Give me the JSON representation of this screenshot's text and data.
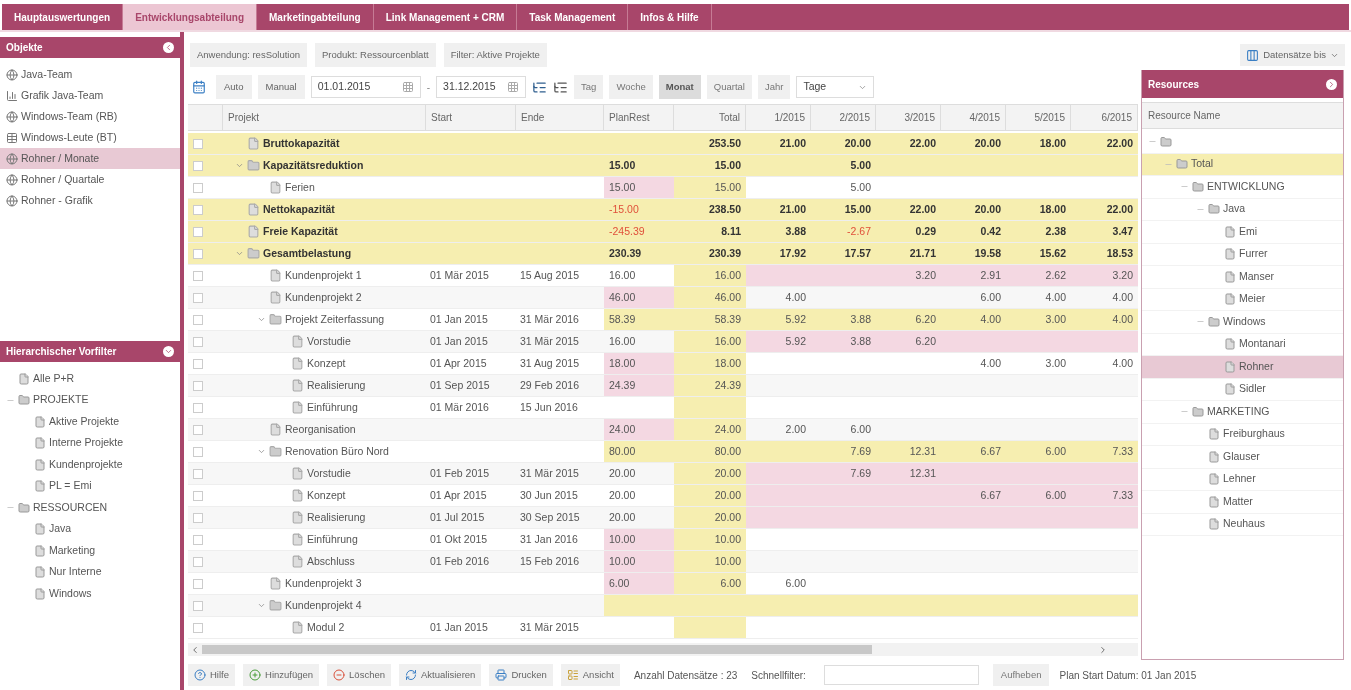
{
  "nav_tabs": [
    {
      "label": "Hauptauswertungen",
      "selected": false
    },
    {
      "label": "Entwicklungsabteilung",
      "selected": true
    },
    {
      "label": "Marketingabteilung",
      "selected": false
    },
    {
      "label": "Link Management + CRM",
      "selected": false
    },
    {
      "label": "Task Management",
      "selected": false
    },
    {
      "label": "Infos & Hilfe",
      "selected": false
    }
  ],
  "objects_panel": {
    "title": "Objekte",
    "items": [
      {
        "label": "Java-Team",
        "kind": "view",
        "selected": false
      },
      {
        "label": "Grafik Java-Team",
        "kind": "chart",
        "selected": false
      },
      {
        "label": "Windows-Team (RB)",
        "kind": "view",
        "selected": false
      },
      {
        "label": "Windows-Leute (BT)",
        "kind": "table",
        "selected": false
      },
      {
        "label": "Rohner / Monate",
        "kind": "view",
        "selected": true
      },
      {
        "label": "Rohner / Quartale",
        "kind": "view",
        "selected": false
      },
      {
        "label": "Rohner - Grafik",
        "kind": "view",
        "selected": false
      }
    ]
  },
  "prefilter_panel": {
    "title": "Hierarchischer Vorfilter",
    "items": [
      {
        "label": "Alle P+R"
      },
      {
        "label": "PROJEKTE",
        "children": [
          {
            "label": "Aktive Projekte"
          },
          {
            "label": "Interne Projekte"
          },
          {
            "label": "Kundenprojekte"
          },
          {
            "label": "PL = Emi"
          }
        ]
      },
      {
        "label": "RESSOURCEN",
        "children": [
          {
            "label": "Java"
          },
          {
            "label": "Marketing"
          },
          {
            "label": "Nur Interne"
          },
          {
            "label": "Windows"
          }
        ]
      }
    ]
  },
  "context_chips": [
    "Anwendung: resSolution",
    "Produkt: Ressourcenblatt",
    "Filter: Aktive Projekte"
  ],
  "records_menu": {
    "label": "Datensätze bis"
  },
  "toolbar": {
    "modes": [
      "Auto",
      "Manual"
    ],
    "date_from": "01.01.2015",
    "separator": "-",
    "date_to": "31.12.2015",
    "periods": [
      {
        "label": "Tag",
        "selected": false
      },
      {
        "label": "Woche",
        "selected": false
      },
      {
        "label": "Monat",
        "selected": true
      },
      {
        "label": "Quartal",
        "selected": false
      },
      {
        "label": "Jahr",
        "selected": false
      }
    ],
    "unit_select": {
      "value": "Tage"
    }
  },
  "table": {
    "columns": [
      "Projekt",
      "Start",
      "Ende",
      "PlanRest",
      "Total",
      "1/2015",
      "2/2015",
      "3/2015",
      "4/2015",
      "5/2015",
      "6/2015"
    ],
    "rows": [
      {
        "name": "Bruttokapazität",
        "kind": "summary",
        "checked": false,
        "values": [
          {
            "flagged": false
          },
          {
            "text": "253.50",
            "flagged": false,
            "negative": false
          },
          {
            "text": "21.00",
            "flagged": false,
            "negative": false
          },
          {
            "text": "20.00",
            "flagged": false,
            "negative": false
          },
          {
            "text": "22.00",
            "flagged": false,
            "negative": false
          },
          {
            "text": "20.00",
            "flagged": false,
            "negative": false
          },
          {
            "text": "18.00",
            "flagged": false,
            "negative": false
          },
          {
            "text": "22.00",
            "flagged": false,
            "negative": false
          }
        ]
      },
      {
        "name": "Kapazitätsreduktion",
        "kind": "summary",
        "checked": false,
        "expanded": true,
        "values": [
          {
            "text": "15.00",
            "flagged": false,
            "negative": false
          },
          {
            "text": "15.00",
            "flagged": false,
            "negative": false
          },
          {
            "flagged": false
          },
          {
            "text": "5.00",
            "flagged": false,
            "negative": false
          },
          {
            "flagged": false
          },
          {
            "flagged": false
          },
          {
            "flagged": false
          },
          {
            "flagged": false
          }
        ],
        "children": [
          {
            "name": "Ferien",
            "kind": "task",
            "checked": false,
            "values": [
              {
                "text": "15.00",
                "flagged": true,
                "negative": false
              },
              {
                "text": "15.00",
                "flagged": false,
                "negative": false
              },
              {
                "flagged": false
              },
              {
                "text": "5.00",
                "flagged": false,
                "negative": false
              },
              {
                "flagged": false
              },
              {
                "flagged": false
              },
              {
                "flagged": false
              },
              {
                "flagged": false
              }
            ]
          }
        ]
      },
      {
        "name": "Nettokapazität",
        "kind": "summary",
        "checked": false,
        "values": [
          {
            "text": "-15.00",
            "flagged": false,
            "negative": true
          },
          {
            "text": "238.50",
            "flagged": false,
            "negative": false
          },
          {
            "text": "21.00",
            "flagged": false,
            "negative": false
          },
          {
            "text": "15.00",
            "flagged": false,
            "negative": false
          },
          {
            "text": "22.00",
            "flagged": false,
            "negative": false
          },
          {
            "text": "20.00",
            "flagged": false,
            "negative": false
          },
          {
            "text": "18.00",
            "flagged": false,
            "negative": false
          },
          {
            "text": "22.00",
            "flagged": false,
            "negative": false
          }
        ]
      },
      {
        "name": "Freie Kapazität",
        "kind": "summary",
        "checked": false,
        "values": [
          {
            "text": "-245.39",
            "flagged": false,
            "negative": true
          },
          {
            "text": "8.11",
            "flagged": false,
            "negative": false
          },
          {
            "text": "3.88",
            "flagged": false,
            "negative": false
          },
          {
            "text": "-2.67",
            "flagged": false,
            "negative": true
          },
          {
            "text": "0.29",
            "flagged": false,
            "negative": false
          },
          {
            "text": "0.42",
            "flagged": false,
            "negative": false
          },
          {
            "text": "2.38",
            "flagged": false,
            "negative": false
          },
          {
            "text": "3.47",
            "flagged": false,
            "negative": false
          }
        ]
      },
      {
        "name": "Gesamtbelastung",
        "kind": "summary",
        "checked": false,
        "expanded": true,
        "values": [
          {
            "text": "230.39",
            "flagged": false,
            "negative": false
          },
          {
            "text": "230.39",
            "flagged": false,
            "negative": false
          },
          {
            "text": "17.92",
            "flagged": false,
            "negative": false
          },
          {
            "text": "17.57",
            "flagged": false,
            "negative": false
          },
          {
            "text": "21.71",
            "flagged": false,
            "negative": false
          },
          {
            "text": "19.58",
            "flagged": false,
            "negative": false
          },
          {
            "text": "15.62",
            "flagged": false,
            "negative": false
          },
          {
            "text": "18.53",
            "flagged": false,
            "negative": false
          }
        ],
        "children": [
          {
            "name": "Kundenprojekt 1",
            "kind": "task",
            "checked": false,
            "start": "01 Mär 2015",
            "end": "15 Aug 2015",
            "values": [
              {
                "text": "16.00",
                "flagged": false,
                "negative": false
              },
              {
                "text": "16.00",
                "flagged": false,
                "negative": false
              },
              {
                "flagged": true
              },
              {
                "flagged": true
              },
              {
                "text": "3.20",
                "flagged": true,
                "negative": false
              },
              {
                "text": "2.91",
                "flagged": true,
                "negative": false
              },
              {
                "text": "2.62",
                "flagged": true,
                "negative": false
              },
              {
                "text": "3.20",
                "flagged": true,
                "negative": false
              }
            ]
          },
          {
            "name": "Kundenprojekt 2",
            "kind": "task",
            "checked": false,
            "values": [
              {
                "text": "46.00",
                "flagged": true,
                "negative": false
              },
              {
                "text": "46.00",
                "flagged": false,
                "negative": false
              },
              {
                "text": "4.00",
                "flagged": false,
                "negative": false
              },
              {
                "flagged": false
              },
              {
                "flagged": false
              },
              {
                "text": "6.00",
                "flagged": false,
                "negative": false
              },
              {
                "text": "4.00",
                "flagged": false,
                "negative": false
              },
              {
                "text": "4.00",
                "flagged": false,
                "negative": false
              }
            ]
          },
          {
            "name": "Projekt Zeiterfassung",
            "kind": "group",
            "checked": false,
            "expanded": true,
            "start": "01 Jan 2015",
            "end": "31 Mär 2016",
            "values": [
              {
                "text": "58.39",
                "flagged": false,
                "negative": false
              },
              {
                "text": "58.39",
                "flagged": false,
                "negative": false
              },
              {
                "text": "5.92",
                "flagged": false,
                "negative": false
              },
              {
                "text": "3.88",
                "flagged": false,
                "negative": false
              },
              {
                "text": "6.20",
                "flagged": false,
                "negative": false
              },
              {
                "text": "4.00",
                "flagged": false,
                "negative": false
              },
              {
                "text": "3.00",
                "flagged": false,
                "negative": false
              },
              {
                "text": "4.00",
                "flagged": false,
                "negative": false
              }
            ],
            "children": [
              {
                "name": "Vorstudie",
                "kind": "task",
                "checked": false,
                "start": "01 Jan 2015",
                "end": "31 Mär 2015",
                "values": [
                  {
                    "text": "16.00",
                    "flagged": false,
                    "negative": false
                  },
                  {
                    "text": "16.00",
                    "flagged": false,
                    "negative": false
                  },
                  {
                    "text": "5.92",
                    "flagged": true,
                    "negative": false
                  },
                  {
                    "text": "3.88",
                    "flagged": true,
                    "negative": false
                  },
                  {
                    "text": "6.20",
                    "flagged": true,
                    "negative": false
                  },
                  {
                    "flagged": true
                  },
                  {
                    "flagged": true
                  },
                  {
                    "flagged": true
                  }
                ]
              },
              {
                "name": "Konzept",
                "kind": "task",
                "checked": false,
                "start": "01 Apr 2015",
                "end": "31 Aug 2015",
                "values": [
                  {
                    "text": "18.00",
                    "flagged": true,
                    "negative": false
                  },
                  {
                    "text": "18.00",
                    "flagged": false,
                    "negative": false
                  },
                  {
                    "flagged": false
                  },
                  {
                    "flagged": false
                  },
                  {
                    "flagged": false
                  },
                  {
                    "text": "4.00",
                    "flagged": false,
                    "negative": false
                  },
                  {
                    "text": "3.00",
                    "flagged": false,
                    "negative": false
                  },
                  {
                    "text": "4.00",
                    "flagged": false,
                    "negative": false
                  }
                ]
              },
              {
                "name": "Realisierung",
                "kind": "task",
                "checked": false,
                "start": "01 Sep 2015",
                "end": "29 Feb 2016",
                "values": [
                  {
                    "text": "24.39",
                    "flagged": true,
                    "negative": false
                  },
                  {
                    "text": "24.39",
                    "flagged": false,
                    "negative": false
                  },
                  {
                    "flagged": false
                  },
                  {
                    "flagged": false
                  },
                  {
                    "flagged": false
                  },
                  {
                    "flagged": false
                  },
                  {
                    "flagged": false
                  },
                  {
                    "flagged": false
                  }
                ]
              },
              {
                "name": "Einführung",
                "kind": "task",
                "checked": false,
                "start": "01 Mär 2016",
                "end": "15 Jun 2016",
                "values": [
                  {
                    "flagged": false
                  },
                  {
                    "flagged": false
                  },
                  {
                    "flagged": false
                  },
                  {
                    "flagged": false
                  },
                  {
                    "flagged": false
                  },
                  {
                    "flagged": false
                  },
                  {
                    "flagged": false
                  },
                  {
                    "flagged": false
                  }
                ]
              }
            ]
          },
          {
            "name": "Reorganisation",
            "kind": "task",
            "checked": false,
            "values": [
              {
                "text": "24.00",
                "flagged": true,
                "negative": false
              },
              {
                "text": "24.00",
                "flagged": false,
                "negative": false
              },
              {
                "text": "2.00",
                "flagged": false,
                "negative": false
              },
              {
                "text": "6.00",
                "flagged": false,
                "negative": false
              },
              {
                "flagged": false
              },
              {
                "flagged": false
              },
              {
                "flagged": false
              },
              {
                "flagged": false
              }
            ]
          },
          {
            "name": "Renovation Büro Nord",
            "kind": "group",
            "checked": false,
            "expanded": true,
            "values": [
              {
                "text": "80.00",
                "flagged": false,
                "negative": false
              },
              {
                "text": "80.00",
                "flagged": false,
                "negative": false
              },
              {
                "flagged": false
              },
              {
                "text": "7.69",
                "flagged": false,
                "negative": false
              },
              {
                "text": "12.31",
                "flagged": false,
                "negative": false
              },
              {
                "text": "6.67",
                "flagged": false,
                "negative": false
              },
              {
                "text": "6.00",
                "flagged": false,
                "negative": false
              },
              {
                "text": "7.33",
                "flagged": false,
                "negative": false
              }
            ],
            "children": [
              {
                "name": "Vorstudie",
                "kind": "task",
                "checked": false,
                "start": "01 Feb 2015",
                "end": "31 Mär 2015",
                "values": [
                  {
                    "text": "20.00",
                    "flagged": false,
                    "negative": false
                  },
                  {
                    "text": "20.00",
                    "flagged": false,
                    "negative": false
                  },
                  {
                    "flagged": true
                  },
                  {
                    "text": "7.69",
                    "flagged": true,
                    "negative": false
                  },
                  {
                    "text": "12.31",
                    "flagged": true,
                    "negative": false
                  },
                  {
                    "flagged": true
                  },
                  {
                    "flagged": true
                  },
                  {
                    "flagged": true
                  }
                ]
              },
              {
                "name": "Konzept",
                "kind": "task",
                "checked": false,
                "start": "01 Apr 2015",
                "end": "30 Jun 2015",
                "values": [
                  {
                    "text": "20.00",
                    "flagged": false,
                    "negative": false
                  },
                  {
                    "text": "20.00",
                    "flagged": false,
                    "negative": false
                  },
                  {
                    "flagged": true
                  },
                  {
                    "flagged": true
                  },
                  {
                    "flagged": true
                  },
                  {
                    "text": "6.67",
                    "flagged": true,
                    "negative": false
                  },
                  {
                    "text": "6.00",
                    "flagged": true,
                    "negative": false
                  },
                  {
                    "text": "7.33",
                    "flagged": true,
                    "negative": false
                  }
                ]
              },
              {
                "name": "Realisierung",
                "kind": "task",
                "checked": false,
                "start": "01 Jul 2015",
                "end": "30 Sep 2015",
                "values": [
                  {
                    "text": "20.00",
                    "flagged": false,
                    "negative": false
                  },
                  {
                    "text": "20.00",
                    "flagged": false,
                    "negative": false
                  },
                  {
                    "flagged": true
                  },
                  {
                    "flagged": true
                  },
                  {
                    "flagged": true
                  },
                  {
                    "flagged": true
                  },
                  {
                    "flagged": true
                  },
                  {
                    "flagged": true
                  }
                ]
              },
              {
                "name": "Einführung",
                "kind": "task",
                "checked": false,
                "start": "01 Okt 2015",
                "end": "31 Jan 2016",
                "values": [
                  {
                    "text": "10.00",
                    "flagged": true,
                    "negative": false
                  },
                  {
                    "text": "10.00",
                    "flagged": false,
                    "negative": false
                  },
                  {
                    "flagged": false
                  },
                  {
                    "flagged": false
                  },
                  {
                    "flagged": false
                  },
                  {
                    "flagged": false
                  },
                  {
                    "flagged": false
                  },
                  {
                    "flagged": false
                  }
                ]
              },
              {
                "name": "Abschluss",
                "kind": "task",
                "checked": false,
                "start": "01 Feb 2016",
                "end": "15 Feb 2016",
                "values": [
                  {
                    "text": "10.00",
                    "flagged": true,
                    "negative": false
                  },
                  {
                    "text": "10.00",
                    "flagged": false,
                    "negative": false
                  },
                  {
                    "flagged": false
                  },
                  {
                    "flagged": false
                  },
                  {
                    "flagged": false
                  },
                  {
                    "flagged": false
                  },
                  {
                    "flagged": false
                  },
                  {
                    "flagged": false
                  }
                ]
              }
            ]
          },
          {
            "name": "Kundenprojekt 3",
            "kind": "task",
            "checked": false,
            "values": [
              {
                "text": "6.00",
                "flagged": true,
                "negative": false
              },
              {
                "text": "6.00",
                "flagged": false,
                "negative": false
              },
              {
                "text": "6.00",
                "flagged": false,
                "negative": false
              },
              {
                "flagged": false
              },
              {
                "flagged": false
              },
              {
                "flagged": false
              },
              {
                "flagged": false
              },
              {
                "flagged": false
              }
            ]
          },
          {
            "name": "Kundenprojekt 4",
            "kind": "group",
            "checked": false,
            "expanded": true,
            "values": [
              {
                "flagged": false
              },
              {
                "flagged": false
              },
              {
                "flagged": false
              },
              {
                "flagged": false
              },
              {
                "flagged": false
              },
              {
                "flagged": false
              },
              {
                "flagged": false
              },
              {
                "flagged": false
              }
            ],
            "children": [
              {
                "name": "Modul 2",
                "kind": "task",
                "checked": false,
                "start": "01 Jan 2015",
                "end": "31 Mär 2015",
                "values": [
                  {
                    "flagged": false
                  },
                  {
                    "flagged": false
                  },
                  {
                    "flagged": false
                  },
                  {
                    "flagged": false
                  },
                  {
                    "flagged": false
                  },
                  {
                    "flagged": false
                  },
                  {
                    "flagged": false
                  },
                  {
                    "flagged": false
                  }
                ]
              }
            ]
          }
        ]
      }
    ]
  },
  "resources_panel": {
    "title": "Resources",
    "column": "Resource Name",
    "items": [
      {
        "kind": "folder",
        "selected": false,
        "children": [
          {
            "label": "Total",
            "kind": "total",
            "selected": false,
            "children": [
              {
                "label": "ENTWICKLUNG",
                "kind": "folder",
                "selected": false,
                "children": [
                  {
                    "label": "Java",
                    "kind": "folder",
                    "selected": false,
                    "children": [
                      {
                        "label": "Emi",
                        "kind": "leaf",
                        "selected": false
                      },
                      {
                        "label": "Furrer",
                        "kind": "leaf",
                        "selected": false
                      },
                      {
                        "label": "Manser",
                        "kind": "leaf",
                        "selected": false
                      },
                      {
                        "label": "Meier",
                        "kind": "leaf",
                        "selected": false
                      }
                    ]
                  },
                  {
                    "label": "Windows",
                    "kind": "folder",
                    "selected": false,
                    "children": [
                      {
                        "label": "Montanari",
                        "kind": "leaf",
                        "selected": false
                      },
                      {
                        "label": "Rohner",
                        "kind": "leaf",
                        "selected": true
                      },
                      {
                        "label": "Sidler",
                        "kind": "leaf",
                        "selected": false
                      }
                    ]
                  }
                ]
              },
              {
                "label": "MARKETING",
                "kind": "folder",
                "selected": false,
                "children": [
                  {
                    "label": "Freiburghaus",
                    "kind": "leaf",
                    "selected": false
                  },
                  {
                    "label": "Glauser",
                    "kind": "leaf",
                    "selected": false
                  },
                  {
                    "label": "Lehner",
                    "kind": "leaf",
                    "selected": false
                  },
                  {
                    "label": "Matter",
                    "kind": "leaf",
                    "selected": false
                  },
                  {
                    "label": "Neuhaus",
                    "kind": "leaf",
                    "selected": false
                  }
                ]
              }
            ]
          }
        ]
      }
    ]
  },
  "footer": {
    "buttons": [
      {
        "label": "Hilfe",
        "kind": "help"
      },
      {
        "label": "Hinzufügen",
        "kind": "add"
      },
      {
        "label": "Löschen",
        "kind": "delete"
      },
      {
        "label": "Aktualisieren",
        "kind": "refresh"
      },
      {
        "label": "Drucken",
        "kind": "print"
      },
      {
        "label": "Ansicht",
        "kind": "view"
      }
    ],
    "record_count": "Anzahl Datensätze : 23",
    "quick_filter_label": "Schnellfilter:",
    "clear_button": "Aufheben",
    "plan_start": "Plan Start Datum: 01 Jan 2015"
  }
}
